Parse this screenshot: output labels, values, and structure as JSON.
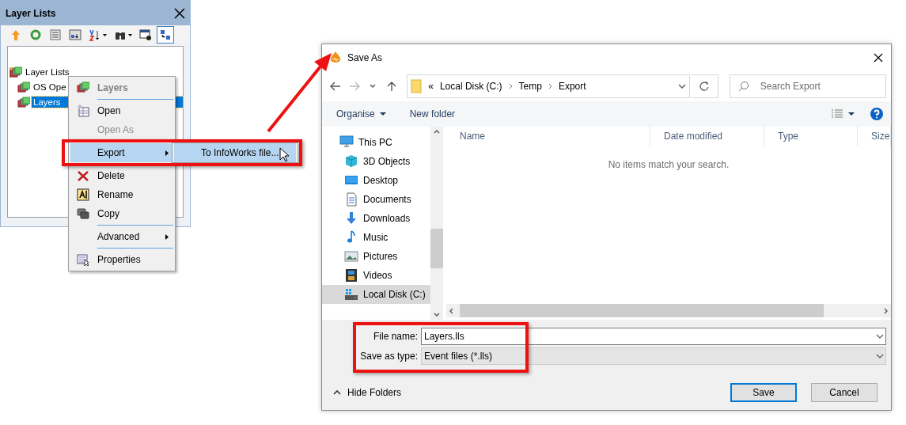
{
  "layer_panel": {
    "title": "Layer Lists",
    "toolbar": [
      {
        "dropdown": false,
        "pressed": false
      },
      {
        "dropdown": false,
        "pressed": false
      },
      {
        "dropdown": false,
        "pressed": false
      },
      {
        "dropdown": false,
        "pressed": false
      },
      {
        "dropdown": true,
        "pressed": false
      },
      {
        "dropdown": true,
        "pressed": false
      },
      {
        "dropdown": false,
        "pressed": false
      },
      {
        "dropdown": false,
        "pressed": true
      }
    ],
    "tree": [
      {
        "label": "Layer Lists",
        "selected": false,
        "children": [
          {
            "label": "OS Ope",
            "selected": false
          },
          {
            "label": "Layers",
            "selected": true
          }
        ]
      }
    ]
  },
  "context_menu": {
    "items": [
      {
        "kind": "header",
        "label": "Layers"
      },
      {
        "kind": "separator"
      },
      {
        "kind": "item",
        "label": "Open",
        "disabled": false,
        "selected": false,
        "submenu": false
      },
      {
        "kind": "item",
        "label": "Open As",
        "disabled": true,
        "selected": false,
        "submenu": false
      },
      {
        "kind": "separator"
      },
      {
        "kind": "item",
        "label": "Export",
        "disabled": false,
        "selected": true,
        "submenu": true
      },
      {
        "kind": "separator"
      },
      {
        "kind": "item",
        "label": "Delete",
        "disabled": false,
        "selected": false,
        "submenu": false
      },
      {
        "kind": "item",
        "label": "Rename",
        "disabled": false,
        "selected": false,
        "submenu": false
      },
      {
        "kind": "item",
        "label": "Copy",
        "disabled": false,
        "selected": false,
        "submenu": false
      },
      {
        "kind": "separator"
      },
      {
        "kind": "item",
        "label": "Advanced",
        "disabled": false,
        "selected": false,
        "submenu": true
      },
      {
        "kind": "separator"
      },
      {
        "kind": "item",
        "label": "Properties",
        "disabled": false,
        "selected": false,
        "submenu": false
      }
    ]
  },
  "submenu": {
    "items": [
      {
        "label": "To InfoWorks file...",
        "selected": true
      }
    ]
  },
  "save_dialog": {
    "title": "Save As",
    "path_overflow": "«",
    "path": [
      "Local Disk (C:)",
      "Temp",
      "Export"
    ],
    "search": {
      "placeholder": "Search Export"
    },
    "toolbar": [
      "Organise",
      "New folder"
    ],
    "nav": [
      {
        "label": "This PC",
        "selected": false,
        "children": [
          {
            "label": "3D Objects",
            "selected": false
          },
          {
            "label": "Desktop",
            "selected": false
          },
          {
            "label": "Documents",
            "selected": false
          },
          {
            "label": "Downloads",
            "selected": false
          },
          {
            "label": "Music",
            "selected": false
          },
          {
            "label": "Pictures",
            "selected": false
          },
          {
            "label": "Videos",
            "selected": false
          },
          {
            "label": "Local Disk (C:)",
            "selected": true
          }
        ]
      }
    ],
    "columns": [
      "Name",
      "Date modified",
      "Type",
      "Size"
    ],
    "empty_message": "No items match your search.",
    "file_name": {
      "label": "File name:",
      "value": "Layers.lls"
    },
    "save_type": {
      "label": "Save as type:",
      "value": "Event files (*.lls)"
    },
    "hide_folders": "Hide Folders",
    "buttons": [
      {
        "label": "Save",
        "default": true
      },
      {
        "label": "Cancel",
        "default": false
      }
    ]
  }
}
